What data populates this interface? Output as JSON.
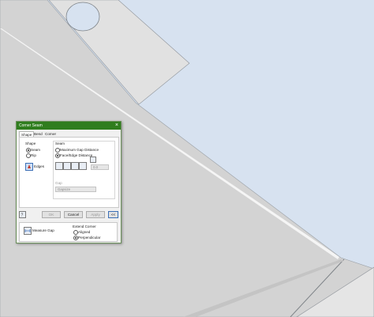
{
  "dialog": {
    "title": "Corner Seam",
    "close_label": "×",
    "tabs": [
      {
        "label": "Shape",
        "active": true
      },
      {
        "label": "Bend",
        "active": false
      },
      {
        "label": "Corner",
        "active": false
      }
    ],
    "shape": {
      "label": "Shape",
      "options": [
        {
          "label": "Seam",
          "selected": true
        },
        {
          "label": "Rip",
          "selected": false
        }
      ],
      "edges_label": "Edges"
    },
    "seam": {
      "label": "Seam",
      "options": [
        {
          "label": "Maximum Gap Distance",
          "selected": false
        },
        {
          "label": "Face/Edge Distance",
          "selected": true
        }
      ],
      "distance_value": "0.0",
      "gap_label": "Gap",
      "gap_value": "Gapsize"
    },
    "buttons": {
      "ok": "OK",
      "cancel": "Cancel",
      "apply": "Apply",
      "more": "<<"
    },
    "measure_gap_label": "Measure Gap",
    "extend_corner": {
      "label": "Extend Corner",
      "options": [
        {
          "label": "Aligned",
          "selected": false
        },
        {
          "label": "Perpendicular",
          "selected": true
        }
      ]
    }
  },
  "colors": {
    "viewport_bg": "#d7e2f0",
    "sheet_face": "#d3d3d3",
    "sheet_edge": "#f2f2f2",
    "title_bar": "#2f7d1e",
    "accent": "#3b6fb6"
  },
  "icons": [
    "close-icon",
    "edges-select-icon",
    "seam-type-icon",
    "flip-icon",
    "help-icon",
    "measure-gap-icon"
  ]
}
